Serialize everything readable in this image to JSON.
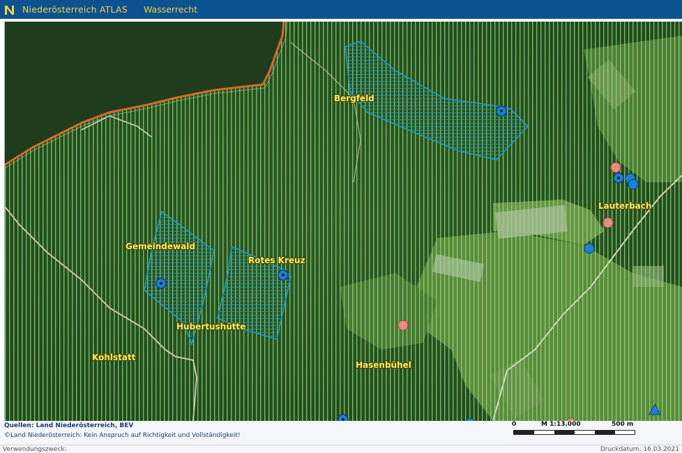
{
  "header": {
    "app_title": "Niederösterreich ATLAS",
    "topic": "Wasserrecht",
    "logo_icon": "noe-logo-icon"
  },
  "map": {
    "place_labels": {
      "bergfeld": "Bergfeld",
      "lauterbach": "Lauterbach",
      "gemeindewald": "Gemeindewald",
      "rotes_kreuz": "Rotes Kreuz",
      "hubertushuette": "Hubertushütte",
      "kohlstatt": "Kohlstatt",
      "hasenbuehel": "Hasenbühel"
    },
    "colors": {
      "water_protection_hatch": "#8fe07a",
      "protection_zone_outline": "#1f9bc8",
      "well_marker": "#1e7fd8",
      "spring_marker": "#ee8a80",
      "boundary_line": "#d8672a"
    }
  },
  "scale": {
    "start": "0",
    "ratio": "M 1:13.000",
    "end": "500 m"
  },
  "footer": {
    "sources": "Quellen: Land Niederösterreich, BEV",
    "disclaimer": "©Land Niederösterreich: Kein Anspruch auf Richtigkeit und Vollständigkeit!",
    "purpose": "Verwendungszweck:",
    "print_date": "Druckdatum: 16.03.2021"
  }
}
